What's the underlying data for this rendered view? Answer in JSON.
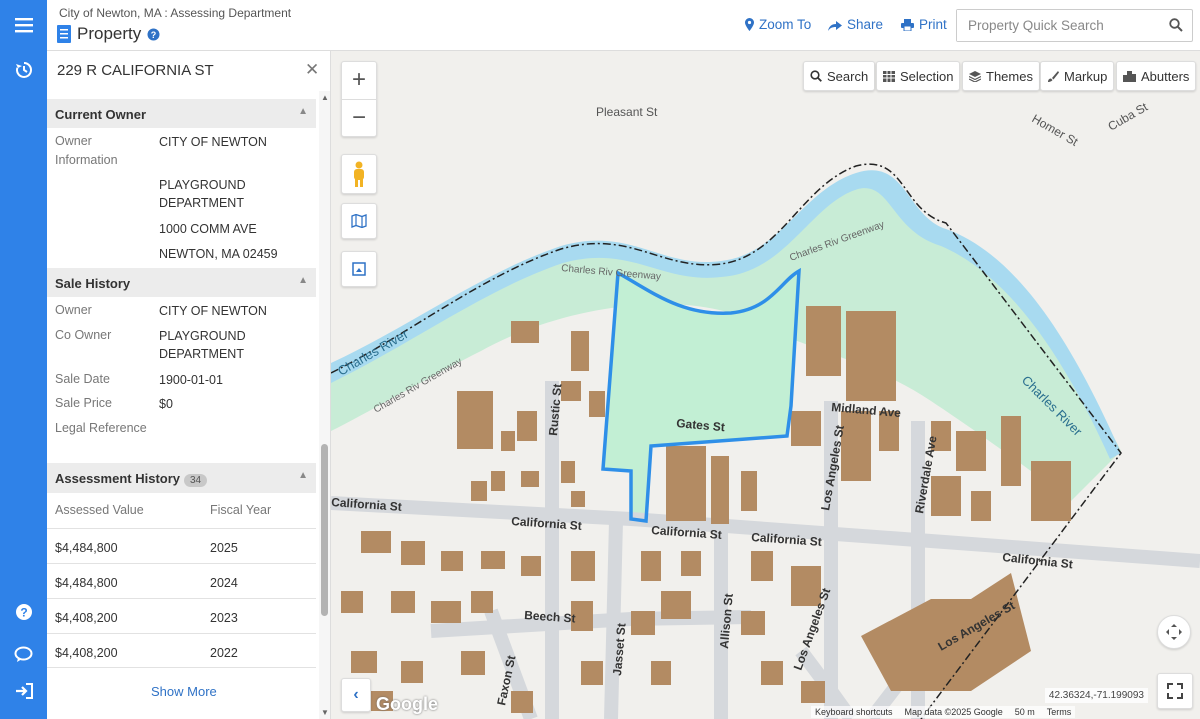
{
  "header": {
    "department": "City of Newton, MA : Assessing Department",
    "title": "Property",
    "zoom_to": "Zoom To",
    "share": "Share",
    "print": "Print",
    "search_placeholder": "Property Quick Search"
  },
  "panel": {
    "address": "229 R CALIFORNIA ST",
    "current_owner": {
      "heading": "Current Owner",
      "label": "Owner Information",
      "lines": [
        "CITY OF NEWTON",
        "PLAYGROUND DEPARTMENT",
        "1000 COMM AVE",
        "NEWTON, MA 02459"
      ]
    },
    "sale_history": {
      "heading": "Sale History",
      "owner_label": "Owner",
      "owner": "CITY OF NEWTON",
      "co_owner_label": "Co Owner",
      "co_owner": "PLAYGROUND DEPARTMENT",
      "sale_date_label": "Sale Date",
      "sale_date": "1900-01-01",
      "sale_price_label": "Sale Price",
      "sale_price": "$0",
      "legal_label": "Legal Reference",
      "legal": ""
    },
    "assessment_history": {
      "heading": "Assessment History",
      "count": "34",
      "col_value": "Assessed Value",
      "col_year": "Fiscal Year",
      "rows": [
        {
          "value": "$4,484,800",
          "year": "2025"
        },
        {
          "value": "$4,484,800",
          "year": "2024"
        },
        {
          "value": "$4,408,200",
          "year": "2023"
        },
        {
          "value": "$4,408,200",
          "year": "2022"
        }
      ],
      "show_more": "Show More"
    }
  },
  "map": {
    "tools": {
      "search": "Search",
      "selection": "Selection",
      "themes": "Themes",
      "markup": "Markup",
      "abutters": "Abutters"
    },
    "coords": "42.36324,-71.199093",
    "attribution": {
      "shortcuts": "Keyboard shortcuts",
      "data": "Map data ©2025 Google",
      "scale": "50 m",
      "terms": "Terms"
    },
    "google": "Google",
    "labels": {
      "pleasant": "Pleasant St",
      "homer": "Homer St",
      "cuba": "Cuba St",
      "charles_river": "Charles River",
      "charles_river2": "Charles River",
      "greenway": "Charles Riv Greenway",
      "gates": "Gates St",
      "midland": "Midland Ave",
      "california": "California St",
      "rustic": "Rustic St",
      "los_angeles": "Los Angeles St",
      "riverdale": "Riverdale Ave",
      "beech": "Beech St",
      "jasset": "Jasset St",
      "allison": "Allison St",
      "faxon": "Faxon St"
    },
    "colors": {
      "water": "#a8daf0",
      "park": "#c8ecd6",
      "building": "#b38b63",
      "parcel": "#2e8fe8"
    }
  }
}
